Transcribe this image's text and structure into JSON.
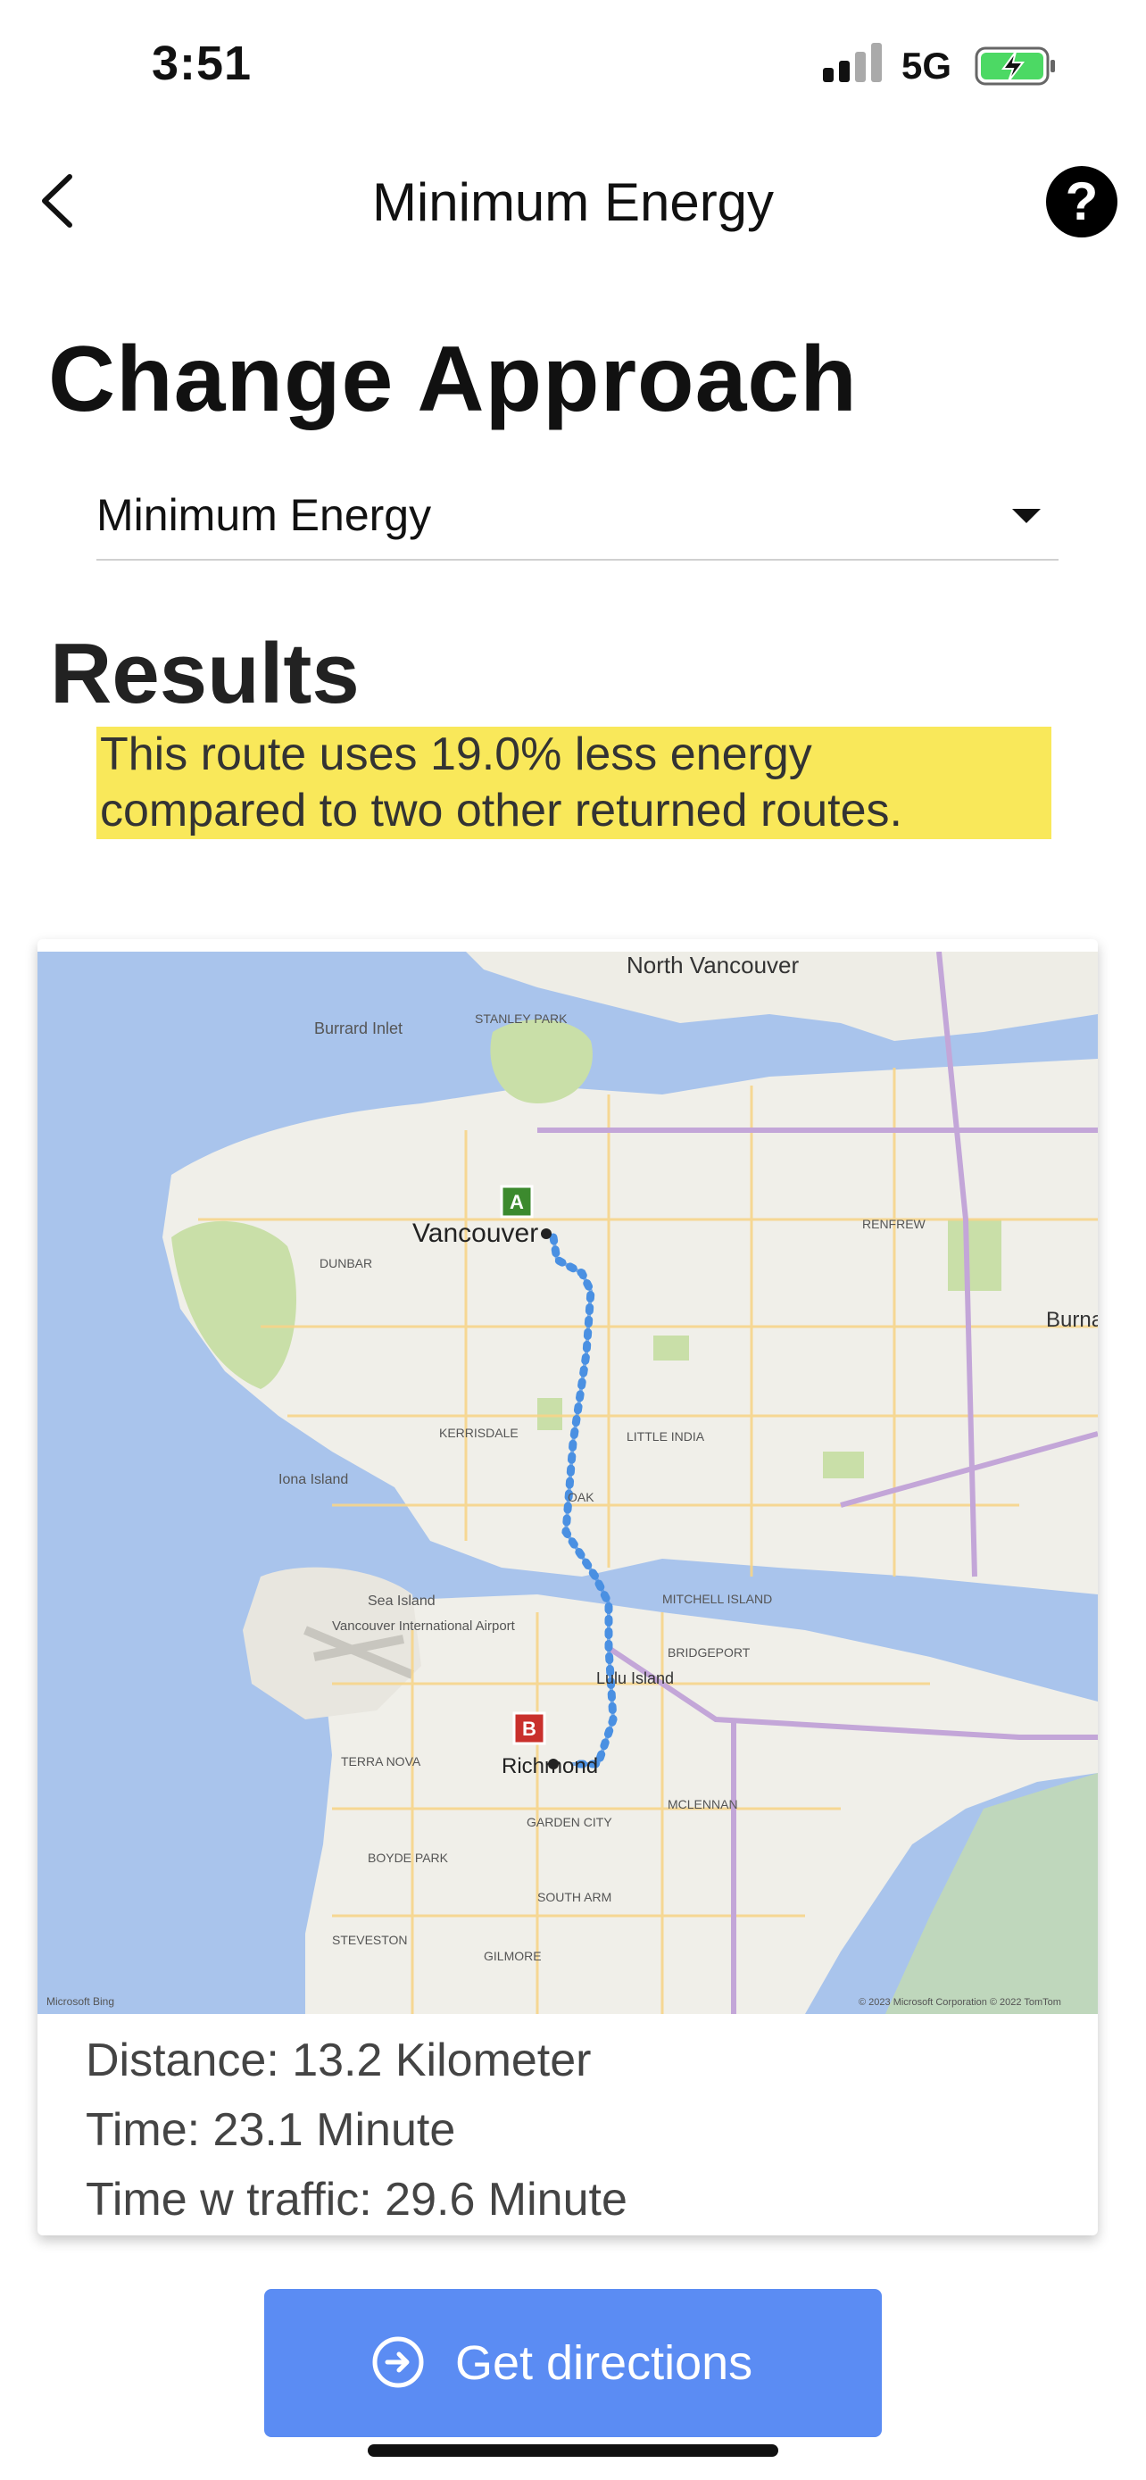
{
  "status_bar": {
    "time": "3:51",
    "network": "5G"
  },
  "nav": {
    "title": "Minimum Energy",
    "help_glyph": "?"
  },
  "approach": {
    "heading": "Change Approach",
    "selected": "Minimum Energy"
  },
  "results": {
    "heading": "Results",
    "line1": "This route uses 19.0% less energy",
    "line2": "compared to two other returned routes."
  },
  "map": {
    "labels": {
      "north_vancouver": "North Vancouver",
      "burrard_inlet": "Burrard Inlet",
      "stanley_park": "STANLEY PARK",
      "vancouver": "Vancouver",
      "richmond": "Richmond",
      "lulu_island": "Lulu Island",
      "sea_island": "Sea Island",
      "iona_island": "Iona Island",
      "dunbar": "DUNBAR",
      "kerrisdale": "KERRISDALE",
      "oak": "OAK",
      "little_india": "LITTLE INDIA",
      "mitchell_island": "MITCHELL ISLAND",
      "bridgeport": "BRIDGEPORT",
      "terra_nova": "TERRA NOVA",
      "garden_city": "GARDEN CITY",
      "mclennan": "MCLENNAN",
      "boyde_park": "BOYDE PARK",
      "south_arm": "SOUTH ARM",
      "steveston": "STEVESTON",
      "gilmore": "GILMORE",
      "burnaby": "Burna",
      "renfrew": "RENFREW",
      "airport": "Vancouver International Airport",
      "marker_a": "A",
      "marker_b": "B",
      "attribution": "© 2023 Microsoft Corporation © 2022 TomTom",
      "provider": "Microsoft Bing"
    },
    "colors": {
      "water": "#a9c4ec",
      "land": "#f0efe9",
      "park": "#c9dfa8",
      "route": "#4a90e2",
      "start": "#3c8a2e",
      "end": "#c9302c"
    }
  },
  "stats": {
    "distance": "Distance: 13.2 Kilometer",
    "time": "Time: 23.1 Minute",
    "traffic": "Time w traffic: 29.6 Minute"
  },
  "button": {
    "label": "Get directions",
    "icon": "arrow-circle-right-icon"
  }
}
